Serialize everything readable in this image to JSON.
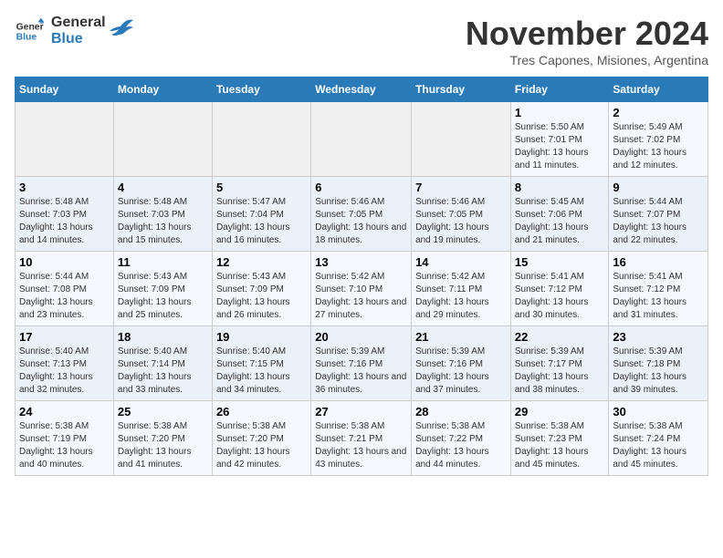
{
  "logo": {
    "line1": "General",
    "line2": "Blue"
  },
  "title": "November 2024",
  "subtitle": "Tres Capones, Misiones, Argentina",
  "days_of_week": [
    "Sunday",
    "Monday",
    "Tuesday",
    "Wednesday",
    "Thursday",
    "Friday",
    "Saturday"
  ],
  "weeks": [
    [
      {
        "day": "",
        "info": ""
      },
      {
        "day": "",
        "info": ""
      },
      {
        "day": "",
        "info": ""
      },
      {
        "day": "",
        "info": ""
      },
      {
        "day": "",
        "info": ""
      },
      {
        "day": "1",
        "info": "Sunrise: 5:50 AM\nSunset: 7:01 PM\nDaylight: 13 hours and 11 minutes."
      },
      {
        "day": "2",
        "info": "Sunrise: 5:49 AM\nSunset: 7:02 PM\nDaylight: 13 hours and 12 minutes."
      }
    ],
    [
      {
        "day": "3",
        "info": "Sunrise: 5:48 AM\nSunset: 7:03 PM\nDaylight: 13 hours and 14 minutes."
      },
      {
        "day": "4",
        "info": "Sunrise: 5:48 AM\nSunset: 7:03 PM\nDaylight: 13 hours and 15 minutes."
      },
      {
        "day": "5",
        "info": "Sunrise: 5:47 AM\nSunset: 7:04 PM\nDaylight: 13 hours and 16 minutes."
      },
      {
        "day": "6",
        "info": "Sunrise: 5:46 AM\nSunset: 7:05 PM\nDaylight: 13 hours and 18 minutes."
      },
      {
        "day": "7",
        "info": "Sunrise: 5:46 AM\nSunset: 7:05 PM\nDaylight: 13 hours and 19 minutes."
      },
      {
        "day": "8",
        "info": "Sunrise: 5:45 AM\nSunset: 7:06 PM\nDaylight: 13 hours and 21 minutes."
      },
      {
        "day": "9",
        "info": "Sunrise: 5:44 AM\nSunset: 7:07 PM\nDaylight: 13 hours and 22 minutes."
      }
    ],
    [
      {
        "day": "10",
        "info": "Sunrise: 5:44 AM\nSunset: 7:08 PM\nDaylight: 13 hours and 23 minutes."
      },
      {
        "day": "11",
        "info": "Sunrise: 5:43 AM\nSunset: 7:09 PM\nDaylight: 13 hours and 25 minutes."
      },
      {
        "day": "12",
        "info": "Sunrise: 5:43 AM\nSunset: 7:09 PM\nDaylight: 13 hours and 26 minutes."
      },
      {
        "day": "13",
        "info": "Sunrise: 5:42 AM\nSunset: 7:10 PM\nDaylight: 13 hours and 27 minutes."
      },
      {
        "day": "14",
        "info": "Sunrise: 5:42 AM\nSunset: 7:11 PM\nDaylight: 13 hours and 29 minutes."
      },
      {
        "day": "15",
        "info": "Sunrise: 5:41 AM\nSunset: 7:12 PM\nDaylight: 13 hours and 30 minutes."
      },
      {
        "day": "16",
        "info": "Sunrise: 5:41 AM\nSunset: 7:12 PM\nDaylight: 13 hours and 31 minutes."
      }
    ],
    [
      {
        "day": "17",
        "info": "Sunrise: 5:40 AM\nSunset: 7:13 PM\nDaylight: 13 hours and 32 minutes."
      },
      {
        "day": "18",
        "info": "Sunrise: 5:40 AM\nSunset: 7:14 PM\nDaylight: 13 hours and 33 minutes."
      },
      {
        "day": "19",
        "info": "Sunrise: 5:40 AM\nSunset: 7:15 PM\nDaylight: 13 hours and 34 minutes."
      },
      {
        "day": "20",
        "info": "Sunrise: 5:39 AM\nSunset: 7:16 PM\nDaylight: 13 hours and 36 minutes."
      },
      {
        "day": "21",
        "info": "Sunrise: 5:39 AM\nSunset: 7:16 PM\nDaylight: 13 hours and 37 minutes."
      },
      {
        "day": "22",
        "info": "Sunrise: 5:39 AM\nSunset: 7:17 PM\nDaylight: 13 hours and 38 minutes."
      },
      {
        "day": "23",
        "info": "Sunrise: 5:39 AM\nSunset: 7:18 PM\nDaylight: 13 hours and 39 minutes."
      }
    ],
    [
      {
        "day": "24",
        "info": "Sunrise: 5:38 AM\nSunset: 7:19 PM\nDaylight: 13 hours and 40 minutes."
      },
      {
        "day": "25",
        "info": "Sunrise: 5:38 AM\nSunset: 7:20 PM\nDaylight: 13 hours and 41 minutes."
      },
      {
        "day": "26",
        "info": "Sunrise: 5:38 AM\nSunset: 7:20 PM\nDaylight: 13 hours and 42 minutes."
      },
      {
        "day": "27",
        "info": "Sunrise: 5:38 AM\nSunset: 7:21 PM\nDaylight: 13 hours and 43 minutes."
      },
      {
        "day": "28",
        "info": "Sunrise: 5:38 AM\nSunset: 7:22 PM\nDaylight: 13 hours and 44 minutes."
      },
      {
        "day": "29",
        "info": "Sunrise: 5:38 AM\nSunset: 7:23 PM\nDaylight: 13 hours and 45 minutes."
      },
      {
        "day": "30",
        "info": "Sunrise: 5:38 AM\nSunset: 7:24 PM\nDaylight: 13 hours and 45 minutes."
      }
    ]
  ]
}
